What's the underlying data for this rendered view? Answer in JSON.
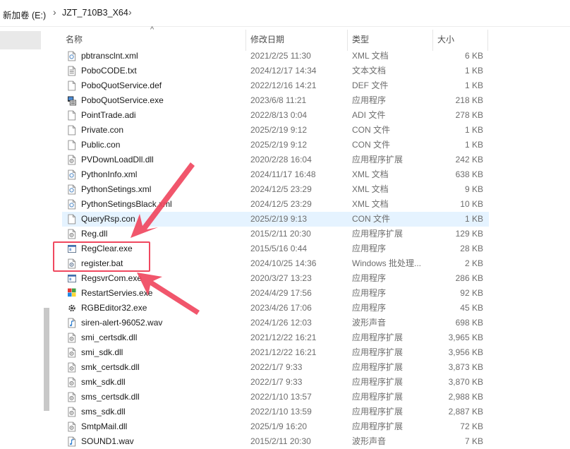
{
  "address": {
    "drive": "新加卷 (E:)",
    "folder": "JZT_710B3_X64"
  },
  "columns": {
    "name": "名称",
    "date": "修改日期",
    "type": "类型",
    "size": "大小"
  },
  "files": [
    {
      "name": "pbtransclnt.xml",
      "date": "2021/2/25 11:30",
      "type": "XML 文档",
      "size": "6 KB",
      "icon": "xml-file-icon"
    },
    {
      "name": "PoboCODE.txt",
      "date": "2024/12/17 14:34",
      "type": "文本文档",
      "size": "1 KB",
      "icon": "text-file-icon"
    },
    {
      "name": "PoboQuotService.def",
      "date": "2022/12/16 14:21",
      "type": "DEF 文件",
      "size": "1 KB",
      "icon": "blank-file-icon"
    },
    {
      "name": "PoboQuotService.exe",
      "date": "2023/6/8 11:21",
      "type": "应用程序",
      "size": "218 KB",
      "icon": "service-exe-icon"
    },
    {
      "name": "PointTrade.adi",
      "date": "2022/8/13 0:04",
      "type": "ADI 文件",
      "size": "278 KB",
      "icon": "blank-file-icon"
    },
    {
      "name": "Private.con",
      "date": "2025/2/19 9:12",
      "type": "CON 文件",
      "size": "1 KB",
      "icon": "blank-file-icon"
    },
    {
      "name": "Public.con",
      "date": "2025/2/19 9:12",
      "type": "CON 文件",
      "size": "1 KB",
      "icon": "blank-file-icon"
    },
    {
      "name": "PVDownLoadDll.dll",
      "date": "2020/2/28 16:04",
      "type": "应用程序扩展",
      "size": "242 KB",
      "icon": "dll-file-icon"
    },
    {
      "name": "PythonInfo.xml",
      "date": "2024/11/17 16:48",
      "type": "XML 文档",
      "size": "638 KB",
      "icon": "xml-file-icon"
    },
    {
      "name": "PythonSetings.xml",
      "date": "2024/12/5 23:29",
      "type": "XML 文档",
      "size": "9 KB",
      "icon": "xml-file-icon"
    },
    {
      "name": "PythonSetingsBlack.xml",
      "date": "2024/12/5 23:29",
      "type": "XML 文档",
      "size": "10 KB",
      "icon": "xml-file-icon"
    },
    {
      "name": "QueryRsp.con",
      "date": "2025/2/19 9:13",
      "type": "CON 文件",
      "size": "1 KB",
      "icon": "blank-file-icon"
    },
    {
      "name": "Reg.dll",
      "date": "2015/2/11 20:30",
      "type": "应用程序扩展",
      "size": "129 KB",
      "icon": "dll-file-icon"
    },
    {
      "name": "RegClear.exe",
      "date": "2015/5/16 0:44",
      "type": "应用程序",
      "size": "28 KB",
      "icon": "exe-window-icon"
    },
    {
      "name": "register.bat",
      "date": "2024/10/25 14:36",
      "type": "Windows 批处理...",
      "size": "2 KB",
      "icon": "batch-file-icon"
    },
    {
      "name": "RegsvrCom.exe",
      "date": "2020/3/27 13:23",
      "type": "应用程序",
      "size": "286 KB",
      "icon": "exe-window-icon"
    },
    {
      "name": "RestartServies.exe",
      "date": "2024/4/29 17:56",
      "type": "应用程序",
      "size": "92 KB",
      "icon": "colorful-exe-icon"
    },
    {
      "name": "RGBEditor32.exe",
      "date": "2023/4/26 17:06",
      "type": "应用程序",
      "size": "45 KB",
      "icon": "gear-exe-icon"
    },
    {
      "name": "siren-alert-96052.wav",
      "date": "2024/1/26 12:03",
      "type": "波形声音",
      "size": "698 KB",
      "icon": "audio-file-icon"
    },
    {
      "name": "smi_certsdk.dll",
      "date": "2021/12/22 16:21",
      "type": "应用程序扩展",
      "size": "3,965 KB",
      "icon": "dll-file-icon"
    },
    {
      "name": "smi_sdk.dll",
      "date": "2021/12/22 16:21",
      "type": "应用程序扩展",
      "size": "3,956 KB",
      "icon": "dll-file-icon"
    },
    {
      "name": "smk_certsdk.dll",
      "date": "2022/1/7 9:33",
      "type": "应用程序扩展",
      "size": "3,873 KB",
      "icon": "dll-file-icon"
    },
    {
      "name": "smk_sdk.dll",
      "date": "2022/1/7 9:33",
      "type": "应用程序扩展",
      "size": "3,870 KB",
      "icon": "dll-file-icon"
    },
    {
      "name": "sms_certsdk.dll",
      "date": "2022/1/10 13:57",
      "type": "应用程序扩展",
      "size": "2,988 KB",
      "icon": "dll-file-icon"
    },
    {
      "name": "sms_sdk.dll",
      "date": "2022/1/10 13:59",
      "type": "应用程序扩展",
      "size": "2,887 KB",
      "icon": "dll-file-icon"
    },
    {
      "name": "SmtpMail.dll",
      "date": "2025/1/9 16:20",
      "type": "应用程序扩展",
      "size": "72 KB",
      "icon": "dll-file-icon"
    },
    {
      "name": "SOUND1.wav",
      "date": "2015/2/11 20:30",
      "type": "波形声音",
      "size": "7 KB",
      "icon": "audio-file-icon"
    }
  ],
  "hovered_file": "QueryRsp.con",
  "highlighted_files": [
    "RegClear.exe",
    "register.bat"
  ],
  "colors": {
    "annotation": "#f0485f",
    "hover": "#e5f3ff"
  }
}
